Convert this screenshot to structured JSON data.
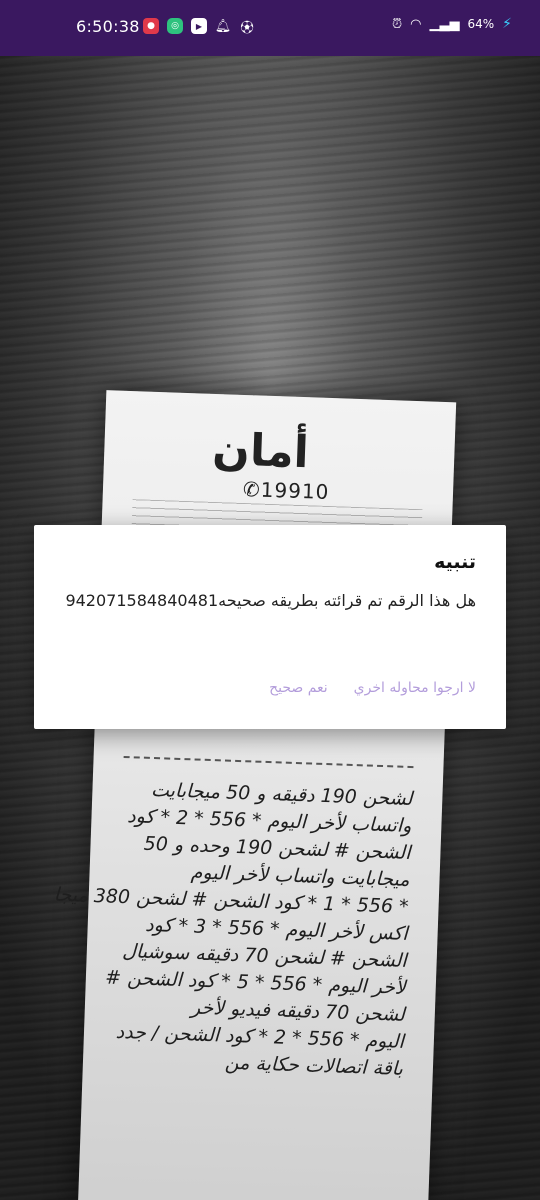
{
  "status_bar": {
    "time": "6:50:38",
    "battery": "64%",
    "icons": [
      "screen-record-icon",
      "green-app-icon",
      "youtube-icon",
      "notification-bell-icon",
      "soccer-ball-icon",
      "alarm-icon",
      "wifi-icon",
      "signal-icon",
      "battery-charging-icon"
    ]
  },
  "receipt": {
    "logo": "أمان",
    "phone": "19910",
    "lines": [
      "لشحن 190 دقيقه و 50 ميجابايت",
      "واتساب لأخر اليوم * 556 * 2 * كود",
      "الشحن # لشحن 190 وحده و 50",
      "ميجابايت واتساب لأخر اليوم",
      "* 556 * 1 * كود الشحن # لشحن 380 ميجا",
      "اكس لأخر اليوم * 556 * 3 * كود",
      "الشحن # لشحن 70 دقيقه سوشيال",
      "لأخر اليوم * 556 * 5 * كود الشحن #",
      "لشحن 70 دقيقه فيديو لأخر",
      "اليوم * 556 * 2 * كود الشحن / جدد",
      "باقة اتصالات حكاية من"
    ]
  },
  "dialog": {
    "title": "تنبيه",
    "message": "هل هذا الرقم تم قرائته بطريقه صحيحه942071584840481",
    "confirm_label": "نعم صحيح",
    "retry_label": "لا ارجوا محاوله اخري"
  }
}
